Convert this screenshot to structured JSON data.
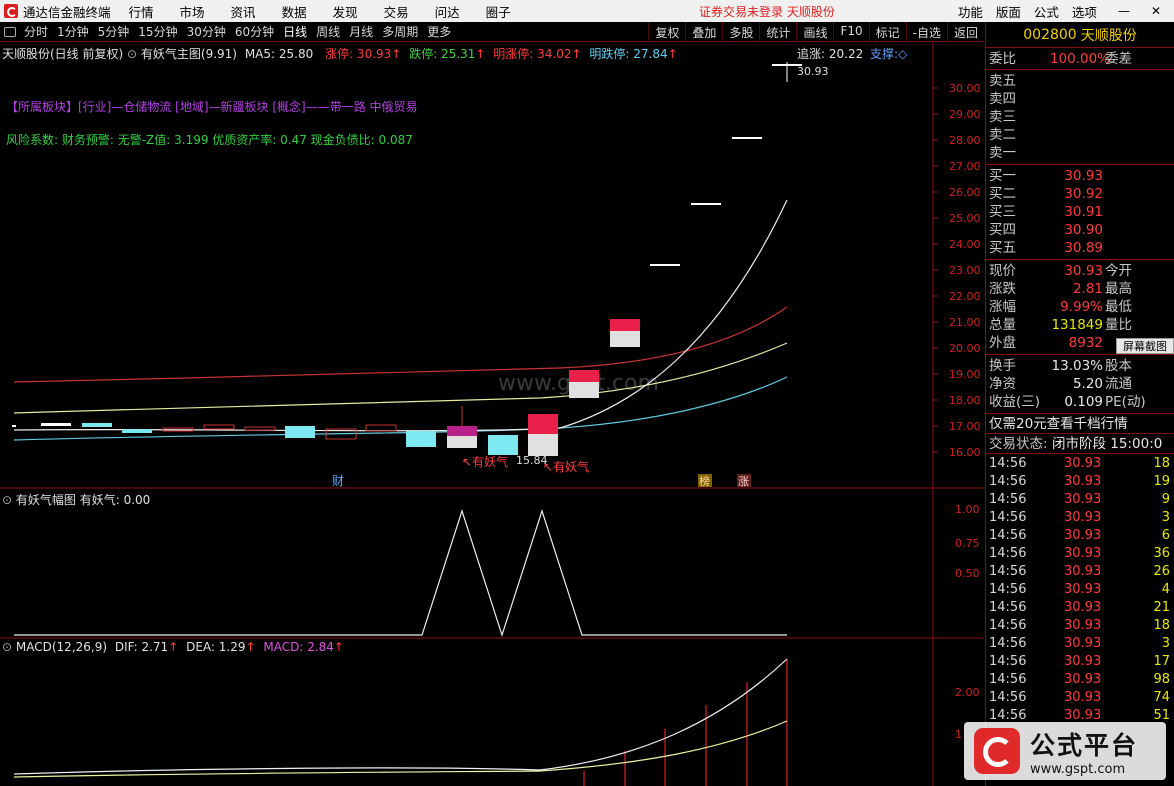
{
  "titlebar": {
    "app_name": "通达信金融终端",
    "menu": [
      "行情",
      "市场",
      "资讯",
      "数据",
      "发现",
      "交易",
      "问达",
      "圈子"
    ],
    "notice": "证券交易未登录  天顺股份",
    "right_menu": [
      "功能",
      "版面",
      "公式",
      "选项"
    ],
    "window_controls": [
      "—",
      "✕"
    ]
  },
  "toolbar": {
    "periods": [
      "分时",
      "1分钟",
      "5分钟",
      "15分钟",
      "30分钟",
      "60分钟",
      "日线",
      "周线",
      "月线",
      "多周期",
      "更多"
    ],
    "active_period": "日线",
    "right_tools": [
      "复权",
      "叠加",
      "多股",
      "统计",
      "画线",
      "F10",
      "标记",
      "-自选",
      "返回"
    ]
  },
  "main_chart": {
    "header": {
      "stock": "天顺股份(日线 前复权)",
      "formula": "有妖气主图(9.91)",
      "ma5": "MA5: 25.80",
      "zt": "涨停: 30.93",
      "dt": "跌停: 25.31",
      "mzt": "明涨停: 34.02",
      "mdt": "明跌停: 27.84",
      "zhuizhang": "追涨: 20.22",
      "zhicheng": "支撑:◇"
    },
    "sector_line": "【所属板块】[行业]—仓储物流 [地域]—新疆板块 [概念]——带一路 中俄贸易",
    "risk_line": "风险系数: 财务预警: 无警-Z值: 3.199 优质资产率: 0.47 现金负债比: 0.087",
    "y_ticks": [
      "30.00",
      "29.00",
      "28.00",
      "27.00",
      "26.00",
      "25.00",
      "24.00",
      "23.00",
      "22.00",
      "21.00",
      "20.00",
      "19.00",
      "18.00",
      "17.00",
      "16.00"
    ],
    "high_label": "30.93",
    "low_label": "15.84",
    "signal_labels": [
      "有妖气",
      "有妖气"
    ],
    "markers": [
      "财",
      "榜",
      "涨"
    ],
    "watermark": "www.gspt.com"
  },
  "sub1": {
    "header": "有妖气幅图  有妖气: 0.00",
    "y_ticks": [
      "1.00",
      "0.75",
      "0.50"
    ]
  },
  "sub2": {
    "header_name": "MACD(12,26,9)",
    "dif": "DIF: 2.71",
    "dea": "DEA: 1.29",
    "macd": "MACD: 2.84",
    "y_ticks": [
      "2.00",
      "1"
    ]
  },
  "panel": {
    "code": "002800",
    "name": "天顺股份",
    "weibi": {
      "label": "委比",
      "value": "100.00%",
      "label2": "委差"
    },
    "sells": [
      {
        "label": "卖五",
        "price": ""
      },
      {
        "label": "卖四",
        "price": ""
      },
      {
        "label": "卖三",
        "price": ""
      },
      {
        "label": "卖二",
        "price": ""
      },
      {
        "label": "卖一",
        "price": ""
      }
    ],
    "buys": [
      {
        "label": "买一",
        "price": "30.93"
      },
      {
        "label": "买二",
        "price": "30.92"
      },
      {
        "label": "买三",
        "price": "30.91"
      },
      {
        "label": "买四",
        "price": "30.90"
      },
      {
        "label": "买五",
        "price": "30.89"
      }
    ],
    "quote": [
      {
        "label": "现价",
        "value": "30.93",
        "label2": "今开"
      },
      {
        "label": "涨跌",
        "value": "2.81",
        "label2": "最高"
      },
      {
        "label": "涨幅",
        "value": "9.99%",
        "label2": "最低"
      },
      {
        "label": "总量",
        "value": "131849",
        "label2": "量比"
      },
      {
        "label": "外盘",
        "value": "8932",
        "label2": ""
      }
    ],
    "fundamentals": [
      {
        "label": "换手",
        "value": "13.03%",
        "label2": "股本"
      },
      {
        "label": "净资",
        "value": "5.20",
        "label2": "流通"
      },
      {
        "label": "收益(三)",
        "value": "0.109",
        "label2": "PE(动)"
      }
    ],
    "promo": "仅需20元查看千档行情",
    "status_label": "交易状态:",
    "status_value": "闭市阶段 15:00:0",
    "trades": [
      {
        "time": "14:56",
        "price": "30.93",
        "vol": "18"
      },
      {
        "time": "14:56",
        "price": "30.93",
        "vol": "19"
      },
      {
        "time": "14:56",
        "price": "30.93",
        "vol": "9"
      },
      {
        "time": "14:56",
        "price": "30.93",
        "vol": "3"
      },
      {
        "time": "14:56",
        "price": "30.93",
        "vol": "6"
      },
      {
        "time": "14:56",
        "price": "30.93",
        "vol": "36"
      },
      {
        "time": "14:56",
        "price": "30.93",
        "vol": "26"
      },
      {
        "time": "14:56",
        "price": "30.93",
        "vol": "4"
      },
      {
        "time": "14:56",
        "price": "30.93",
        "vol": "21"
      },
      {
        "time": "14:56",
        "price": "30.93",
        "vol": "18"
      },
      {
        "time": "14:56",
        "price": "30.93",
        "vol": "3"
      },
      {
        "time": "14:56",
        "price": "30.93",
        "vol": "17"
      },
      {
        "time": "14:56",
        "price": "30.93",
        "vol": "98"
      },
      {
        "time": "14:56",
        "price": "30.93",
        "vol": "74"
      },
      {
        "time": "14:56",
        "price": "30.93",
        "vol": "51"
      }
    ],
    "screenshot_btn": "屏幕截图"
  },
  "logo": {
    "big": "公式平台",
    "small": "www.gspt.com"
  }
}
